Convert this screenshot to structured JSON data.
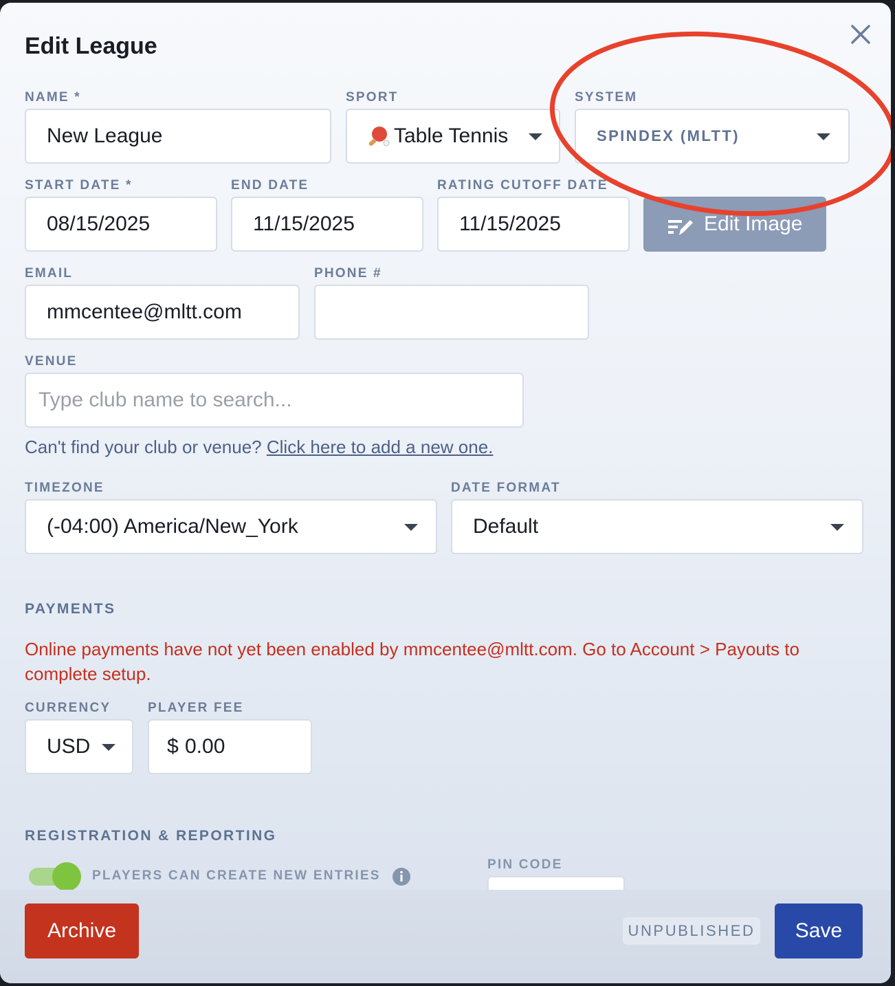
{
  "dialog": {
    "title": "Edit League"
  },
  "fields": {
    "name": {
      "label": "NAME *",
      "value": "New League"
    },
    "sport": {
      "label": "SPORT",
      "value": "Table Tennis",
      "icon": "ping-pong-paddle-icon"
    },
    "system": {
      "label": "SYSTEM",
      "value": "SPINDEX (MLTT)"
    },
    "start_date": {
      "label": "START DATE *",
      "value": "08/15/2025"
    },
    "end_date": {
      "label": "END DATE",
      "value": "11/15/2025"
    },
    "rating_cutoff_date": {
      "label": "RATING CUTOFF DATE *",
      "value": "11/15/2025"
    },
    "email": {
      "label": "EMAIL",
      "value": "mmcentee@mltt.com"
    },
    "phone": {
      "label": "PHONE #",
      "value": ""
    },
    "venue": {
      "label": "VENUE",
      "placeholder": "Type club name to search..."
    },
    "timezone": {
      "label": "TIMEZONE",
      "value": "(-04:00) America/New_York"
    },
    "date_format": {
      "label": "DATE FORMAT",
      "value": "Default"
    },
    "currency": {
      "label": "CURRENCY",
      "value": "USD"
    },
    "player_fee": {
      "label": "PLAYER FEE",
      "symbol": "$",
      "value": "0.00"
    },
    "pin_code": {
      "label": "PIN CODE",
      "value": ""
    }
  },
  "buttons": {
    "edit_image": "Edit Image",
    "archive": "Archive",
    "save": "Save"
  },
  "venue_help": {
    "text": "Can't find your club or venue?",
    "link": "Click here to add a new one."
  },
  "payments": {
    "heading": "PAYMENTS",
    "warning": "Online payments have not yet been enabled by mmcentee@mltt.com. Go to Account > Payouts to complete setup."
  },
  "registration": {
    "heading": "REGISTRATION & REPORTING",
    "players_can_create_label": "PLAYERS CAN CREATE NEW ENTRIES",
    "players_can_create_on": true
  },
  "status": "UNPUBLISHED",
  "colors": {
    "primary": "#2849a8",
    "danger": "#c3331e",
    "label": "#6b7d99",
    "toggle_on": "#7fc43f",
    "annotation": "#e8412c"
  }
}
